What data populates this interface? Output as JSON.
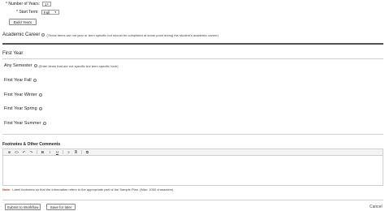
{
  "build": {
    "years_label": "* Number of Years:",
    "years_value": "1",
    "start_label": "* Start Term:",
    "start_value": "Fall",
    "build_button": "Build Years"
  },
  "career": {
    "label": "Academic Career",
    "note": "(These items are not year or term specific but should be completed at some point during the student's academic career)"
  },
  "year": {
    "title": "First Year",
    "any_label": "Any Semester",
    "any_note": "(Enter items that are not specific but term specific here)",
    "terms": [
      "First Year Fall",
      "First Year Winter",
      "First Year Spring",
      "First Year Summer"
    ]
  },
  "footnotes": {
    "title": "Footnotes & Other Comments",
    "toolbar": [
      "⊕",
      "<>",
      "↶",
      "↷",
      "B",
      "I",
      "U",
      "≡",
      "≣",
      "⧉"
    ],
    "note_label": "Note:",
    "note_text": "Label footnotes so that the information refers to the appropriate part of the Sample Plan. (Max: 1000 characters)"
  },
  "actions": {
    "submit": "Submit to Workflow",
    "save": "Save for later",
    "cancel": "Cancel"
  }
}
